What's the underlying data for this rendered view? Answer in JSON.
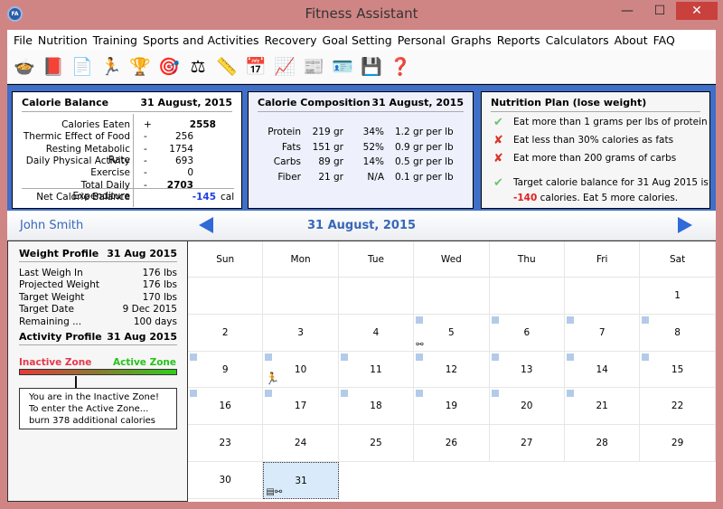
{
  "window": {
    "title": "Fitness Assistant",
    "logo": "FA",
    "minimize": "—",
    "maximize": "☐",
    "close": "✕"
  },
  "menu": [
    "File",
    "Nutrition",
    "Training",
    "Sports and Activities",
    "Recovery",
    "Goal Setting",
    "Personal",
    "Graphs",
    "Reports",
    "Calculators",
    "About",
    "FAQ"
  ],
  "toolbar": [
    {
      "icon": "food-icon",
      "g": "🍲"
    },
    {
      "icon": "recipe-book-icon",
      "g": "📕"
    },
    {
      "icon": "workout-log-icon",
      "g": "📄"
    },
    {
      "icon": "running-icon",
      "g": "🏃"
    },
    {
      "icon": "trophy-icon",
      "g": "🏆"
    },
    {
      "icon": "target-icon",
      "g": "🎯"
    },
    {
      "icon": "scale-icon",
      "g": "⚖"
    },
    {
      "icon": "measuring-tape-icon",
      "g": "📏"
    },
    {
      "icon": "calendar-icon",
      "g": "📅"
    },
    {
      "icon": "line-chart-icon",
      "g": "📈"
    },
    {
      "icon": "report-icon",
      "g": "📰"
    },
    {
      "icon": "profile-card-icon",
      "g": "🪪"
    },
    {
      "icon": "export-save-icon",
      "g": "💾"
    },
    {
      "icon": "help-icon",
      "g": "❓"
    }
  ],
  "calorie_balance": {
    "title": "Calorie Balance",
    "date": "31 August, 2015",
    "rows": [
      {
        "label": "Calories Eaten",
        "sign": "+",
        "value": "2558",
        "bold": true
      },
      {
        "label": "Thermic Effect of Food",
        "sign": "-",
        "value": "256"
      },
      {
        "label": "Resting Metabolic Rate",
        "sign": "-",
        "value": "1754"
      },
      {
        "label": "Daily Physical Activity",
        "sign": "-",
        "value": "693"
      },
      {
        "label": "Exercise",
        "sign": "-",
        "value": "0"
      },
      {
        "label": "Total Daily Expenditure",
        "sign": "-",
        "value": "2703",
        "bold": true
      }
    ],
    "net_label": "Net Calorie Balance",
    "net_value": "-145",
    "net_unit": "cal"
  },
  "calorie_composition": {
    "title": "Calorie Composition",
    "date": "31 August, 2015",
    "rows": [
      [
        "Protein",
        "219 gr",
        "34%",
        "1.2 gr per lb"
      ],
      [
        "Fats",
        "151 gr",
        "52%",
        "0.9 gr per lb"
      ],
      [
        "Carbs",
        "89 gr",
        "14%",
        "0.5 gr per lb"
      ],
      [
        "Fiber",
        "21 gr",
        "N/A",
        "0.1 gr per lb"
      ]
    ]
  },
  "nutrition_plan": {
    "title": "Nutrition Plan  (lose weight)",
    "items": [
      {
        "ok": true,
        "text": "Eat more than 1 grams per lbs of protein"
      },
      {
        "ok": false,
        "text": "Eat less than 30% calories as fats"
      },
      {
        "ok": false,
        "text": "Eat more than 200 grams of carbs"
      }
    ],
    "target_line1": "Target calorie balance for 31 Aug 2015 is",
    "target_value": "-140",
    "target_line2": " calories. Eat 5 more calories.",
    "target_ok": true
  },
  "nav": {
    "user": "John Smith",
    "date": "31 August, 2015"
  },
  "weight_profile": {
    "title": "Weight Profile",
    "date": "31 Aug 2015",
    "rows": [
      [
        "Last Weigh In",
        "176 lbs"
      ],
      [
        "Projected Weight",
        "176 lbs"
      ],
      [
        "Target Weight",
        "170 lbs"
      ],
      [
        "Target Date",
        "9 Dec 2015"
      ],
      [
        "Remaining ...",
        "100 days"
      ]
    ]
  },
  "activity_profile": {
    "title": "Activity Profile",
    "date": "31 Aug 2015",
    "inactive": "Inactive Zone",
    "active": "Active Zone",
    "level": 0.0,
    "msg": [
      "You are in the Inactive Zone!",
      "To enter the Active Zone...",
      "burn 378 additional calories"
    ]
  },
  "calendar": {
    "days": [
      "Sun",
      "Mon",
      "Tue",
      "Wed",
      "Thu",
      "Fri",
      "Sat"
    ],
    "first_weekday": 6,
    "num_days": 31,
    "selected": 31,
    "marked": [
      5,
      6,
      7,
      8,
      9,
      10,
      11,
      12,
      13,
      14,
      15,
      16,
      17,
      18,
      19,
      20,
      21
    ],
    "icons": {
      "5": "dumbbell-icon",
      "10": "running-icon",
      "31": "scale-dumbbell-icon"
    }
  },
  "colors": {
    "accent": "#3767b9",
    "panel_blue": "#3f6fc9",
    "negative_blue": "#1f3fe0",
    "negative_red": "#e02020",
    "ok": "#6cc46c",
    "fail": "#d9322a"
  }
}
